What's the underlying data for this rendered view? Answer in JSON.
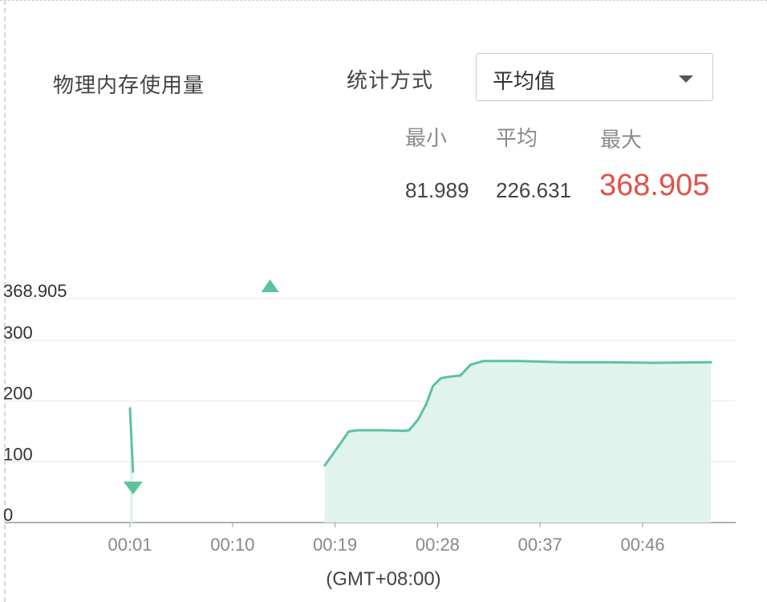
{
  "panel": {
    "metric_title": "物理内存使用量",
    "stat_method_label": "统计方式",
    "stat_method_value": "平均值",
    "stats": {
      "min_label": "最小",
      "avg_label": "平均",
      "max_label": "最大",
      "min_value": "81.989",
      "avg_value": "226.631",
      "max_value": "368.905"
    },
    "colors": {
      "series_line": "#5cc49a",
      "series_fill": "#e0f3ec",
      "max_value": "#e0524a"
    }
  },
  "chart_data": {
    "type": "area",
    "x_ticks": [
      "00:01",
      "00:10",
      "00:19",
      "00:28",
      "00:37",
      "00:46"
    ],
    "y_ticks": [
      "0",
      "100",
      "200",
      "300",
      "368.905"
    ],
    "y_tick_values": [
      0,
      100,
      200,
      300,
      368.905
    ],
    "ylim": [
      0,
      368.905
    ],
    "xlabel": "(GMT+08:00)",
    "grid": true,
    "series": [
      {
        "segments": [
          [
            [
              0.0,
              188
            ],
            [
              0.27,
              84
            ]
          ],
          [
            [
              17.1,
              94
            ],
            [
              18.5,
              131
            ],
            [
              19.2,
              150
            ],
            [
              20,
              152
            ],
            [
              22,
              152
            ],
            [
              24,
              151
            ],
            [
              24.5,
              152
            ],
            [
              25.3,
              170
            ],
            [
              26,
              195
            ],
            [
              26.6,
              225
            ],
            [
              27.3,
              238
            ],
            [
              28,
              240
            ],
            [
              29,
              242
            ],
            [
              29.9,
              260
            ],
            [
              31,
              266
            ],
            [
              34,
              266
            ],
            [
              38,
              264
            ],
            [
              42,
              264
            ],
            [
              46,
              263
            ],
            [
              51,
              264
            ]
          ]
        ]
      }
    ],
    "markers": [
      {
        "kind": "max",
        "x": 12.3,
        "value": 368.905
      },
      {
        "kind": "min",
        "x": 0.27,
        "value": 81.989
      }
    ]
  }
}
